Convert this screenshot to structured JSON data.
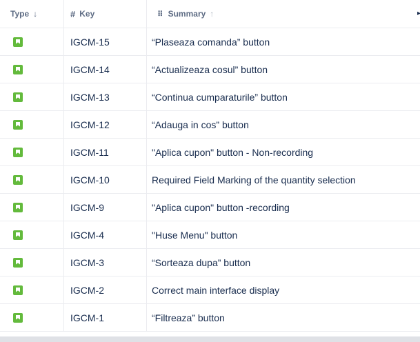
{
  "header": {
    "type_label": "Type",
    "key_label": "Key",
    "summary_label": "Summary",
    "type_sort_icon": "arrow-down-icon",
    "key_icon": "hash-icon",
    "summary_grip_icon": "drag-grip-icon",
    "summary_sort_icon": "arrow-up-icon"
  },
  "rows": [
    {
      "type_icon": "story-icon",
      "key": "IGCM-15",
      "summary": "“Plaseaza comanda” button"
    },
    {
      "type_icon": "story-icon",
      "key": "IGCM-14",
      "summary": "“Actualizeaza cosul” button"
    },
    {
      "type_icon": "story-icon",
      "key": "IGCM-13",
      "summary": "“Continua cumparaturile” button"
    },
    {
      "type_icon": "story-icon",
      "key": "IGCM-12",
      "summary": "“Adauga in cos” button"
    },
    {
      "type_icon": "story-icon",
      "key": "IGCM-11",
      "summary": "\"Aplica cupon\" button - Non-recording"
    },
    {
      "type_icon": "story-icon",
      "key": "IGCM-10",
      "summary": "Required Field Marking of the quantity selection"
    },
    {
      "type_icon": "story-icon",
      "key": "IGCM-9",
      "summary": "\"Aplica cupon\" button -recording"
    },
    {
      "type_icon": "story-icon",
      "key": "IGCM-4",
      "summary": "\"Huse Menu\" button"
    },
    {
      "type_icon": "story-icon",
      "key": "IGCM-3",
      "summary": "“Sorteaza dupa” button"
    },
    {
      "type_icon": "story-icon",
      "key": "IGCM-2",
      "summary": "Correct main interface display"
    },
    {
      "type_icon": "story-icon",
      "key": "IGCM-1",
      "summary": "“Filtreaza” button"
    }
  ],
  "colors": {
    "story_icon": "#63ba3c",
    "header_text": "#5e6c84",
    "row_text": "#172b4d",
    "divider": "#ebecf0",
    "scrollbar": "#dfe1e6"
  }
}
